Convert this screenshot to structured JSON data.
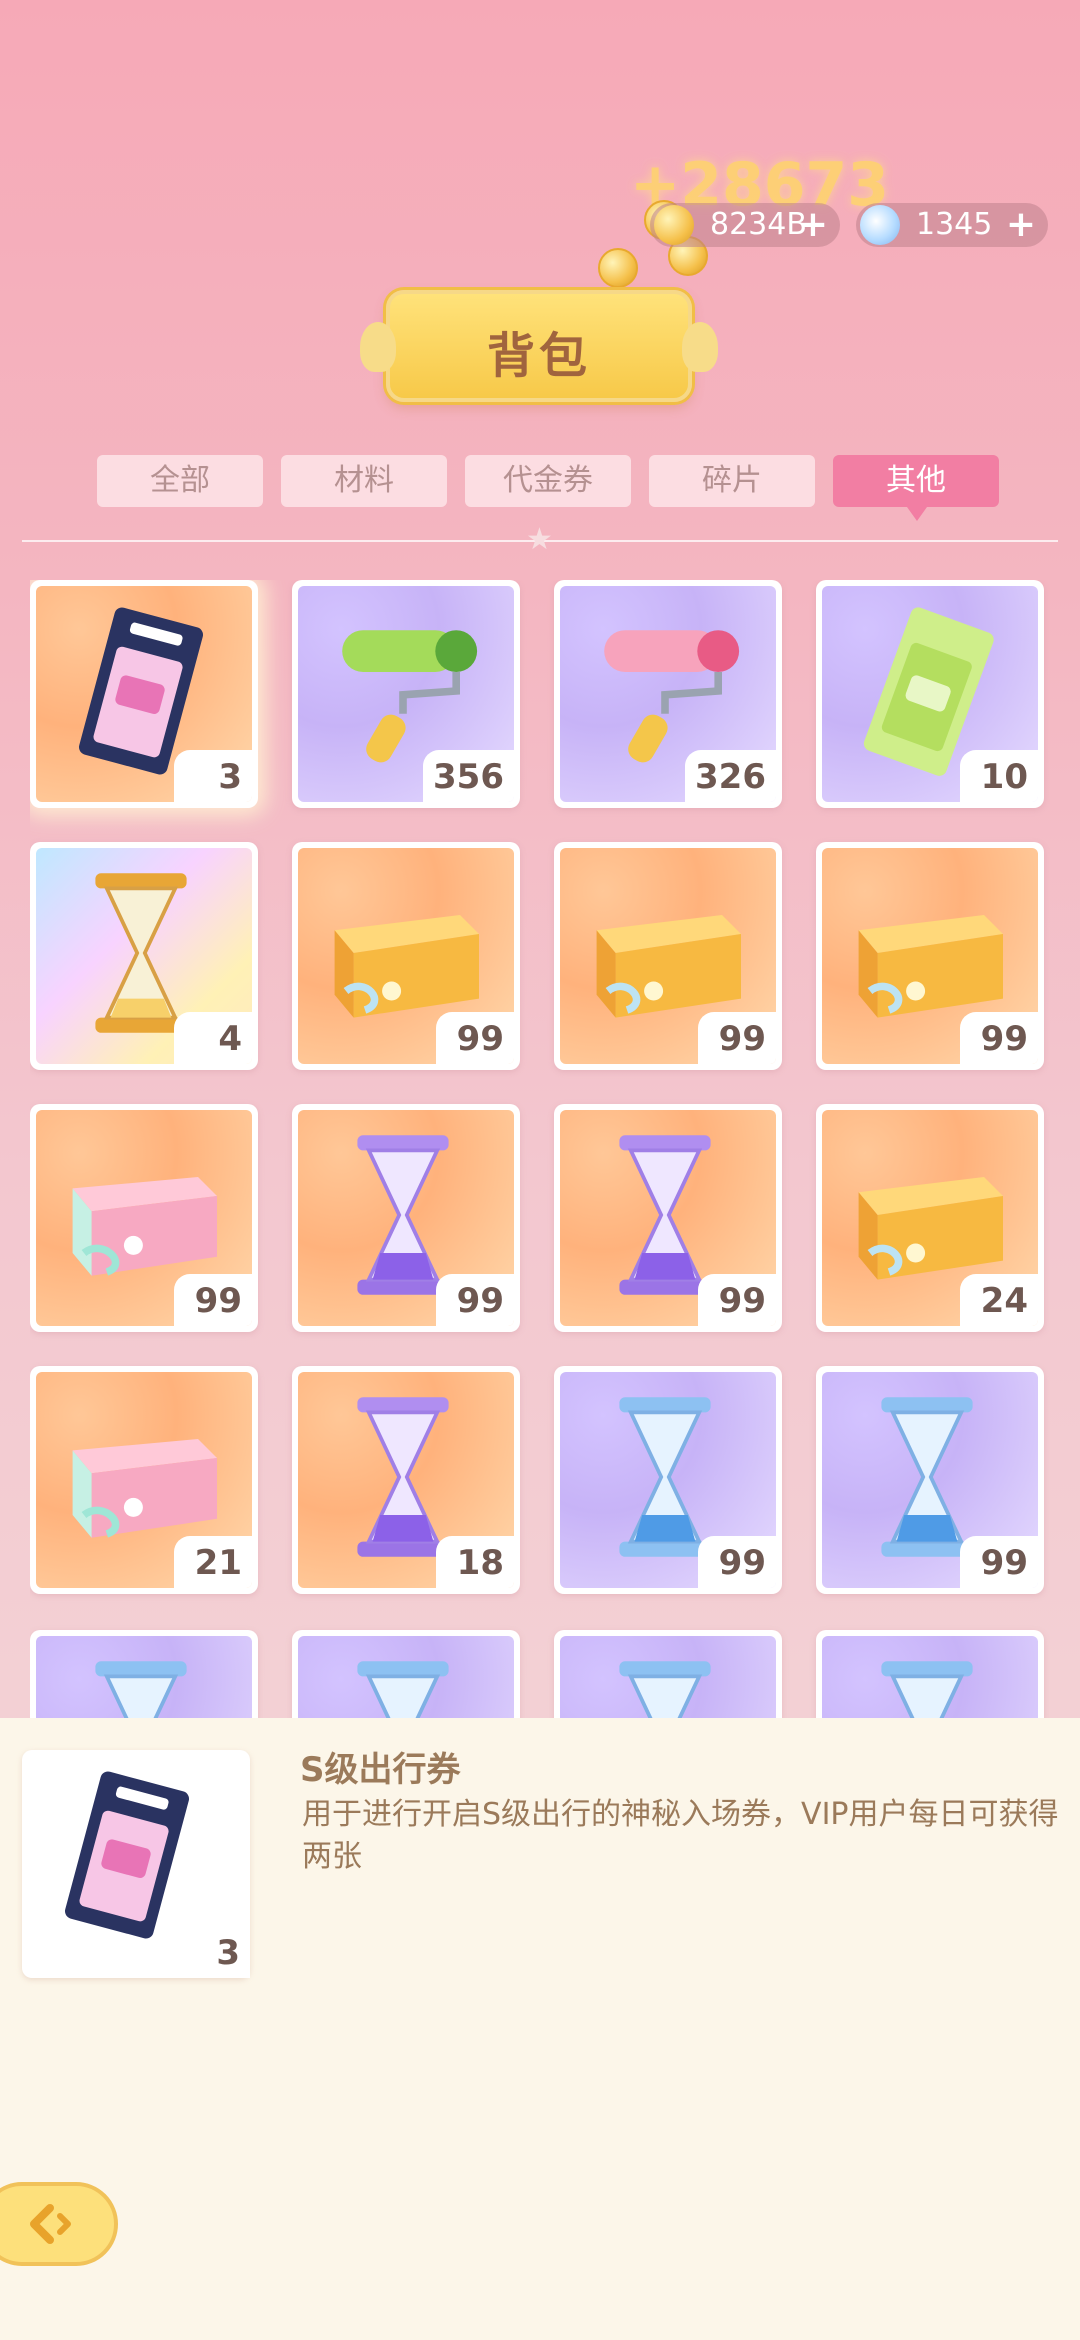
{
  "currency": {
    "gain_popup": "+28673",
    "gold": {
      "value": "8234B",
      "icon": "coin-icon",
      "add": "+"
    },
    "gem": {
      "value": "1345",
      "icon": "snowflake-gem-icon",
      "add": "+"
    }
  },
  "header": {
    "title": "背包"
  },
  "tabs": [
    {
      "label": "全部"
    },
    {
      "label": "材料"
    },
    {
      "label": "代金券"
    },
    {
      "label": "碎片"
    },
    {
      "label": "其他"
    }
  ],
  "active_tab": "其他",
  "items": [
    {
      "icon": "ticket-navy-icon",
      "count": "3",
      "bg": "orange"
    },
    {
      "icon": "paint-roller-green-icon",
      "count": "356",
      "bg": "purple"
    },
    {
      "icon": "paint-roller-pink-icon",
      "count": "326",
      "bg": "purple"
    },
    {
      "icon": "ticket-green-icon",
      "count": "10",
      "bg": "purple"
    },
    {
      "icon": "hourglass-gold-icon",
      "count": "4",
      "bg": "rainbow"
    },
    {
      "icon": "orange-box-icon",
      "count": "99",
      "bg": "orange"
    },
    {
      "icon": "orange-box-icon",
      "count": "99",
      "bg": "orange"
    },
    {
      "icon": "orange-box-icon",
      "count": "99",
      "bg": "orange"
    },
    {
      "icon": "pink-box-icon",
      "count": "99",
      "bg": "orange"
    },
    {
      "icon": "hourglass-purple-icon",
      "count": "99",
      "bg": "orange"
    },
    {
      "icon": "hourglass-purple-icon",
      "count": "99",
      "bg": "orange"
    },
    {
      "icon": "orange-box-icon",
      "count": "24",
      "bg": "orange"
    },
    {
      "icon": "pink-box-icon",
      "count": "21",
      "bg": "orange"
    },
    {
      "icon": "hourglass-purple-icon",
      "count": "18",
      "bg": "orange"
    },
    {
      "icon": "hourglass-blue-icon",
      "count": "99",
      "bg": "purple"
    },
    {
      "icon": "hourglass-blue-icon",
      "count": "99",
      "bg": "purple"
    },
    {
      "icon": "hourglass-blue-icon",
      "count": "",
      "bg": "purple"
    },
    {
      "icon": "hourglass-blue-icon",
      "count": "",
      "bg": "purple"
    },
    {
      "icon": "hourglass-blue-icon",
      "count": "",
      "bg": "purple"
    },
    {
      "icon": "hourglass-blue-icon",
      "count": "",
      "bg": "purple"
    }
  ],
  "detail": {
    "name": "S级出行券",
    "description": "用于进行开启S级出行的神秘入场券，VIP用户每日可获得两张",
    "count": "3",
    "icon": "ticket-navy-icon"
  },
  "back_button": {
    "icon": "back-arrow-icon"
  }
}
